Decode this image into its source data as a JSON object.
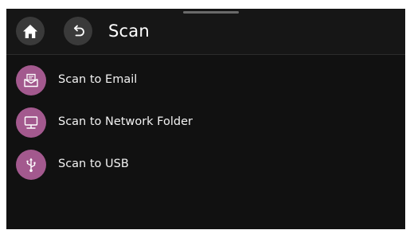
{
  "header": {
    "title": "Scan"
  },
  "menu": {
    "items": [
      {
        "label": "Scan to Email",
        "icon": "email-icon"
      },
      {
        "label": "Scan to Network Folder",
        "icon": "network-folder-icon"
      },
      {
        "label": "Scan to USB",
        "icon": "usb-icon"
      }
    ]
  },
  "colors": {
    "background": "#111111",
    "header": "#161616",
    "button": "#3a3a3a",
    "accent": "#a3598e",
    "text": "#ffffff"
  }
}
